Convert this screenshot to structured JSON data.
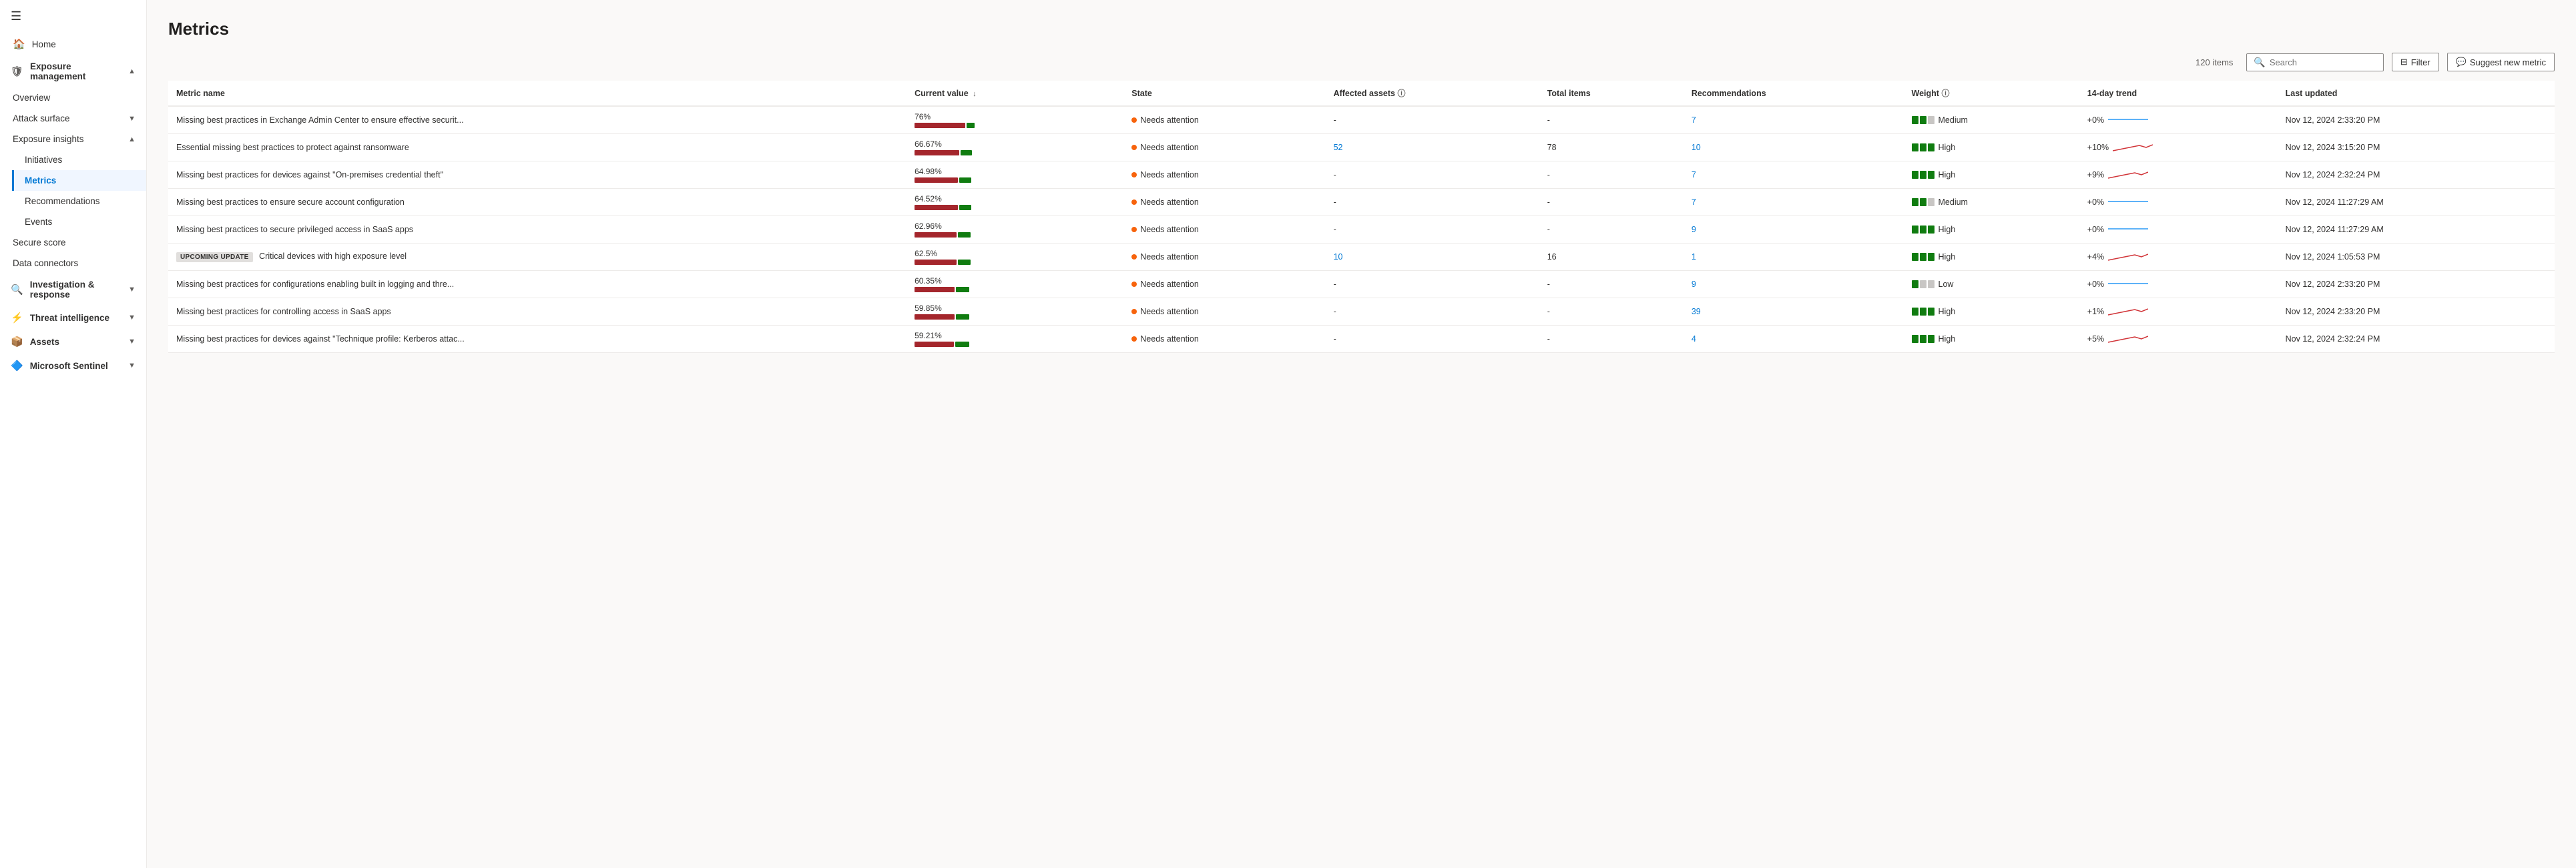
{
  "sidebar": {
    "hamburger": "☰",
    "home_label": "Home",
    "sections": [
      {
        "id": "exposure-management",
        "label": "Exposure management",
        "expanded": true,
        "items": [
          {
            "id": "overview",
            "label": "Overview",
            "active": false
          },
          {
            "id": "attack-surface",
            "label": "Attack surface",
            "active": false,
            "hasArrow": true
          },
          {
            "id": "exposure-insights",
            "label": "Exposure insights",
            "active": false,
            "hasArrow": true,
            "subitems": [
              {
                "id": "initiatives",
                "label": "Initiatives",
                "active": false
              },
              {
                "id": "metrics",
                "label": "Metrics",
                "active": true
              },
              {
                "id": "recommendations",
                "label": "Recommendations",
                "active": false
              },
              {
                "id": "events",
                "label": "Events",
                "active": false
              }
            ]
          },
          {
            "id": "secure-score",
            "label": "Secure score",
            "active": false
          },
          {
            "id": "data-connectors",
            "label": "Data connectors",
            "active": false
          }
        ]
      },
      {
        "id": "investigation-response",
        "label": "Investigation & response",
        "expanded": false,
        "items": []
      },
      {
        "id": "threat-intelligence",
        "label": "Threat intelligence",
        "expanded": false,
        "items": []
      },
      {
        "id": "assets",
        "label": "Assets",
        "expanded": false,
        "items": []
      },
      {
        "id": "microsoft-sentinel",
        "label": "Microsoft Sentinel",
        "expanded": false,
        "items": []
      }
    ]
  },
  "page": {
    "title": "Metrics"
  },
  "toolbar": {
    "items_count": "120 items",
    "search_placeholder": "Search",
    "filter_label": "Filter",
    "suggest_label": "Suggest new metric"
  },
  "table": {
    "columns": [
      {
        "id": "metric-name",
        "label": "Metric name"
      },
      {
        "id": "current-value",
        "label": "Current value",
        "sortable": true,
        "sort_dir": "desc"
      },
      {
        "id": "state",
        "label": "State"
      },
      {
        "id": "affected-assets",
        "label": "Affected assets",
        "info": true
      },
      {
        "id": "total-items",
        "label": "Total items"
      },
      {
        "id": "recommendations",
        "label": "Recommendations"
      },
      {
        "id": "weight",
        "label": "Weight",
        "info": true
      },
      {
        "id": "trend",
        "label": "14-day trend"
      },
      {
        "id": "last-updated",
        "label": "Last updated"
      }
    ],
    "rows": [
      {
        "id": "row-1",
        "metric_name": "Missing best practices in Exchange Admin Center to ensure effective securit...",
        "badge": null,
        "current_value": "76%",
        "bar_red_pct": 76,
        "bar_green_pct": 24,
        "state": "Needs attention",
        "affected_assets": "-",
        "affected_assets_link": false,
        "total_items": "-",
        "recommendations": "7",
        "recommendations_link": true,
        "weight": "Medium",
        "weight_filled": 2,
        "weight_half": 0,
        "weight_empty": 1,
        "trend": "+0%",
        "trend_color": "#2899f5",
        "last_updated": "Nov 12, 2024 2:33:20 PM"
      },
      {
        "id": "row-2",
        "metric_name": "Essential missing best practices to protect against ransomware",
        "badge": null,
        "current_value": "66.67%",
        "bar_red_pct": 67,
        "bar_green_pct": 33,
        "state": "Needs attention",
        "affected_assets": "52",
        "affected_assets_link": true,
        "total_items": "78",
        "recommendations": "10",
        "recommendations_link": true,
        "weight": "High",
        "weight_filled": 3,
        "weight_half": 0,
        "weight_empty": 0,
        "trend": "+10%",
        "trend_color": "#d13438",
        "last_updated": "Nov 12, 2024 3:15:20 PM"
      },
      {
        "id": "row-3",
        "metric_name": "Missing best practices for devices against \"On-premises credential theft\"",
        "badge": null,
        "current_value": "64.98%",
        "bar_red_pct": 65,
        "bar_green_pct": 35,
        "state": "Needs attention",
        "affected_assets": "-",
        "affected_assets_link": false,
        "total_items": "-",
        "recommendations": "7",
        "recommendations_link": true,
        "weight": "High",
        "weight_filled": 3,
        "weight_half": 0,
        "weight_empty": 0,
        "trend": "+9%",
        "trend_color": "#d13438",
        "last_updated": "Nov 12, 2024 2:32:24 PM"
      },
      {
        "id": "row-4",
        "metric_name": "Missing best practices to ensure secure account configuration",
        "badge": null,
        "current_value": "64.52%",
        "bar_red_pct": 65,
        "bar_green_pct": 35,
        "state": "Needs attention",
        "affected_assets": "-",
        "affected_assets_link": false,
        "total_items": "-",
        "recommendations": "7",
        "recommendations_link": true,
        "weight": "Medium",
        "weight_filled": 2,
        "weight_half": 0,
        "weight_empty": 1,
        "trend": "+0%",
        "trend_color": "#2899f5",
        "last_updated": "Nov 12, 2024 11:27:29 AM"
      },
      {
        "id": "row-5",
        "metric_name": "Missing best practices to secure privileged access in SaaS apps",
        "badge": null,
        "current_value": "62.96%",
        "bar_red_pct": 63,
        "bar_green_pct": 37,
        "state": "Needs attention",
        "affected_assets": "-",
        "affected_assets_link": false,
        "total_items": "-",
        "recommendations": "9",
        "recommendations_link": true,
        "weight": "High",
        "weight_filled": 3,
        "weight_half": 0,
        "weight_empty": 0,
        "trend": "+0%",
        "trend_color": "#2899f5",
        "last_updated": "Nov 12, 2024 11:27:29 AM"
      },
      {
        "id": "row-6",
        "metric_name": "Critical devices with high exposure level",
        "badge": "UPCOMING UPDATE",
        "current_value": "62.5%",
        "bar_red_pct": 63,
        "bar_green_pct": 37,
        "state": "Needs attention",
        "affected_assets": "10",
        "affected_assets_link": true,
        "total_items": "16",
        "recommendations": "1",
        "recommendations_link": true,
        "weight": "High",
        "weight_filled": 3,
        "weight_half": 0,
        "weight_empty": 0,
        "trend": "+4%",
        "trend_color": "#d13438",
        "last_updated": "Nov 12, 2024 1:05:53 PM"
      },
      {
        "id": "row-7",
        "metric_name": "Missing best practices for configurations enabling built in logging and thre...",
        "badge": null,
        "current_value": "60.35%",
        "bar_red_pct": 60,
        "bar_green_pct": 40,
        "state": "Needs attention",
        "affected_assets": "-",
        "affected_assets_link": false,
        "total_items": "-",
        "recommendations": "9",
        "recommendations_link": true,
        "weight": "Low",
        "weight_filled": 1,
        "weight_half": 0,
        "weight_empty": 2,
        "trend": "+0%",
        "trend_color": "#2899f5",
        "last_updated": "Nov 12, 2024 2:33:20 PM"
      },
      {
        "id": "row-8",
        "metric_name": "Missing best practices for controlling access in SaaS apps",
        "badge": null,
        "current_value": "59.85%",
        "bar_red_pct": 60,
        "bar_green_pct": 40,
        "state": "Needs attention",
        "affected_assets": "-",
        "affected_assets_link": false,
        "total_items": "-",
        "recommendations": "39",
        "recommendations_link": true,
        "weight": "High",
        "weight_filled": 3,
        "weight_half": 0,
        "weight_empty": 0,
        "trend": "+1%",
        "trend_color": "#d13438",
        "last_updated": "Nov 12, 2024 2:33:20 PM"
      },
      {
        "id": "row-9",
        "metric_name": "Missing best practices for devices against \"Technique profile: Kerberos attac...",
        "badge": null,
        "current_value": "59.21%",
        "bar_red_pct": 59,
        "bar_green_pct": 41,
        "state": "Needs attention",
        "affected_assets": "-",
        "affected_assets_link": false,
        "total_items": "-",
        "recommendations": "4",
        "recommendations_link": true,
        "weight": "High",
        "weight_filled": 3,
        "weight_half": 0,
        "weight_empty": 0,
        "trend": "+5%",
        "trend_color": "#d13438",
        "last_updated": "Nov 12, 2024 2:32:24 PM"
      }
    ]
  }
}
